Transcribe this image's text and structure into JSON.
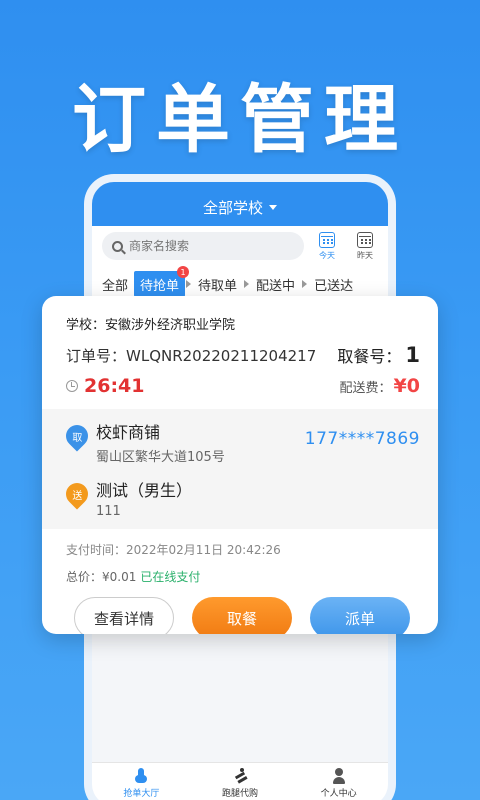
{
  "promo": {
    "title": "订单管理"
  },
  "app": {
    "header": {
      "school_filter": "全部学校"
    },
    "search": {
      "placeholder": "商家名搜索"
    },
    "date_filters": [
      {
        "label": "今天",
        "icon": "calendar-icon"
      },
      {
        "label": "昨天",
        "icon": "calendar-icon"
      }
    ],
    "tabs": [
      {
        "label": "全部"
      },
      {
        "label": "待抢单",
        "badge": "1"
      },
      {
        "label": "待取单"
      },
      {
        "label": "配送中"
      },
      {
        "label": "已送达"
      }
    ],
    "bottom_nav": [
      {
        "label": "抢单大厅",
        "icon": "hand-tap-icon"
      },
      {
        "label": "跑腿代购",
        "icon": "runner-icon"
      },
      {
        "label": "个人中心",
        "icon": "person-icon"
      }
    ]
  },
  "order": {
    "school": "学校：安徽涉外经济职业学院",
    "order_no": "订单号：WLQNR20220211204217",
    "meal_no_label": "取餐号：",
    "meal_no": "1",
    "countdown": "26:41",
    "fee_label": "配送费：",
    "fee": "¥0",
    "pickup": {
      "tag": "取",
      "name": "校虾商铺",
      "address": "蜀山区繁华大道105号"
    },
    "delivery": {
      "tag": "送",
      "name": "测试（男生）",
      "address": "111"
    },
    "phone": "177****7869",
    "pay_time": "支付时间：2022年02月11日 20:42:26",
    "total_label": "总价：¥0.01",
    "pay_status": "已在线支付",
    "buttons": {
      "detail": "查看详情",
      "pickup": "取餐",
      "dispatch": "派单"
    }
  },
  "colors": {
    "brand": "#2f8ff0",
    "countdown": "#e23232",
    "fee": "#f24545",
    "paid": "#2ab06b",
    "pickup_button": "#f07a12"
  }
}
